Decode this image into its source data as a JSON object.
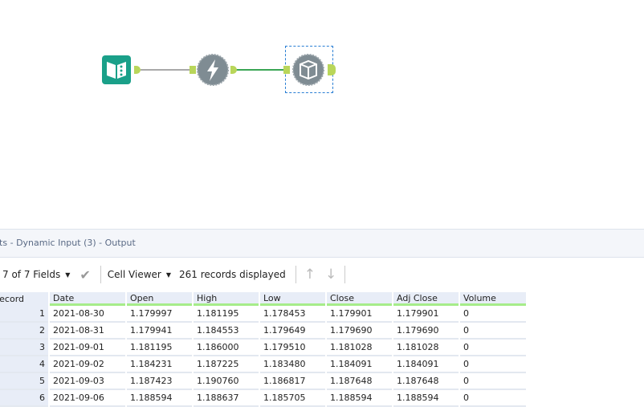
{
  "workflow": {
    "tools": [
      {
        "name": "Input Data"
      },
      {
        "name": "Dynamic Input"
      },
      {
        "name": "Browse"
      }
    ]
  },
  "results": {
    "title": "lts",
    "subtitle": "- Dynamic Input (3) - Output"
  },
  "toolbar": {
    "fields": "7 of 7 Fields",
    "viewer": "Cell Viewer",
    "records": "261 records displayed"
  },
  "table": {
    "headers": [
      "Record",
      "Date",
      "Open",
      "High",
      "Low",
      "Close",
      "Adj Close",
      "Volume"
    ],
    "rows": [
      [
        "1",
        "2021-08-30",
        "1.179997",
        "1.181195",
        "1.178453",
        "1.179901",
        "1.179901",
        "0"
      ],
      [
        "2",
        "2021-08-31",
        "1.179941",
        "1.184553",
        "1.179649",
        "1.179690",
        "1.179690",
        "0"
      ],
      [
        "3",
        "2021-09-01",
        "1.181195",
        "1.186000",
        "1.179510",
        "1.181028",
        "1.181028",
        "0"
      ],
      [
        "4",
        "2021-09-02",
        "1.184231",
        "1.187225",
        "1.183480",
        "1.184091",
        "1.184091",
        "0"
      ],
      [
        "5",
        "2021-09-03",
        "1.187423",
        "1.190760",
        "1.186817",
        "1.187648",
        "1.187648",
        "0"
      ],
      [
        "6",
        "2021-09-06",
        "1.188594",
        "1.188637",
        "1.185705",
        "1.188594",
        "1.188594",
        "0"
      ]
    ]
  }
}
